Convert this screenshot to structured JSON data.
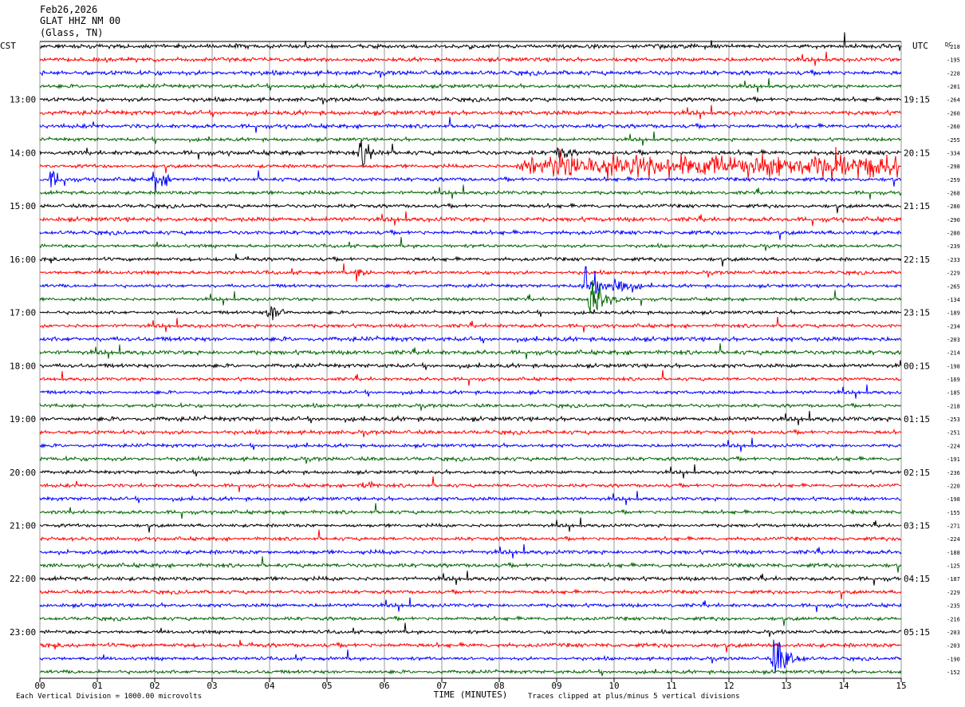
{
  "header": {
    "date": "Feb26,2026",
    "station": "GLAT HHZ NM 00",
    "location": "(Glass, TN)"
  },
  "left_axis_title": "CST",
  "right_axis_title": "UTC",
  "dc_label": "DC",
  "colors": {
    "trace": [
      "#000000",
      "#ff0000",
      "#0000ff",
      "#006400"
    ],
    "grid": "#999999"
  },
  "chart_data": {
    "type": "line",
    "title": "GLAT HHZ NM 00",
    "xlabel": "TIME (MINUTES)",
    "x_ticks": [
      "00",
      "01",
      "02",
      "03",
      "04",
      "05",
      "06",
      "07",
      "08",
      "09",
      "10",
      "11",
      "12",
      "13",
      "14",
      "15"
    ],
    "xlim": [
      0,
      15
    ],
    "rows_per_hour": 4,
    "minutes_per_row": 15,
    "left_time_labels": [
      "13:00",
      "14:00",
      "15:00",
      "16:00",
      "17:00",
      "18:00",
      "19:00",
      "20:00",
      "21:00",
      "22:00",
      "23:00"
    ],
    "right_time_labels": [
      "19:15",
      "20:15",
      "21:15",
      "22:15",
      "23:15",
      "00:15",
      "01:15",
      "02:15",
      "03:15",
      "04:15",
      "05:15"
    ],
    "dc_offsets": [
      218,
      195,
      228,
      201,
      264,
      260,
      260,
      255,
      334,
      298,
      259,
      268,
      280,
      290,
      280,
      239,
      233,
      229,
      265,
      134,
      189,
      234,
      203,
      214,
      198,
      169,
      185,
      218,
      253,
      251,
      224,
      191,
      236,
      220,
      198,
      155,
      271,
      224,
      188,
      125,
      187,
      229,
      235,
      216,
      203,
      203,
      190,
      152
    ],
    "events": [
      {
        "row": 8,
        "minute": 5.6,
        "amplitude": 14
      },
      {
        "row": 8,
        "minute": 9.0,
        "amplitude": 9
      },
      {
        "row": 9,
        "minute": 8.3,
        "amplitude": 14,
        "span": 6.7
      },
      {
        "row": 10,
        "minute": 2.0,
        "amplitude": 11
      },
      {
        "row": 10,
        "minute": 0.2,
        "amplitude": 9
      },
      {
        "row": 17,
        "minute": 5.5,
        "amplitude": 6
      },
      {
        "row": 18,
        "minute": 9.5,
        "amplitude": 18
      },
      {
        "row": 18,
        "minute": 10.0,
        "amplitude": 14
      },
      {
        "row": 19,
        "minute": 9.6,
        "amplitude": 22
      },
      {
        "row": 20,
        "minute": 4.0,
        "amplitude": 10
      },
      {
        "row": 33,
        "minute": 5.6,
        "amplitude": 6
      },
      {
        "row": 46,
        "minute": 12.8,
        "amplitude": 22
      }
    ],
    "footer_left": "Each Vertical Division = 1000.00 microvolts",
    "footer_right": "Traces clipped at plus/minus 5 vertical divisions"
  }
}
